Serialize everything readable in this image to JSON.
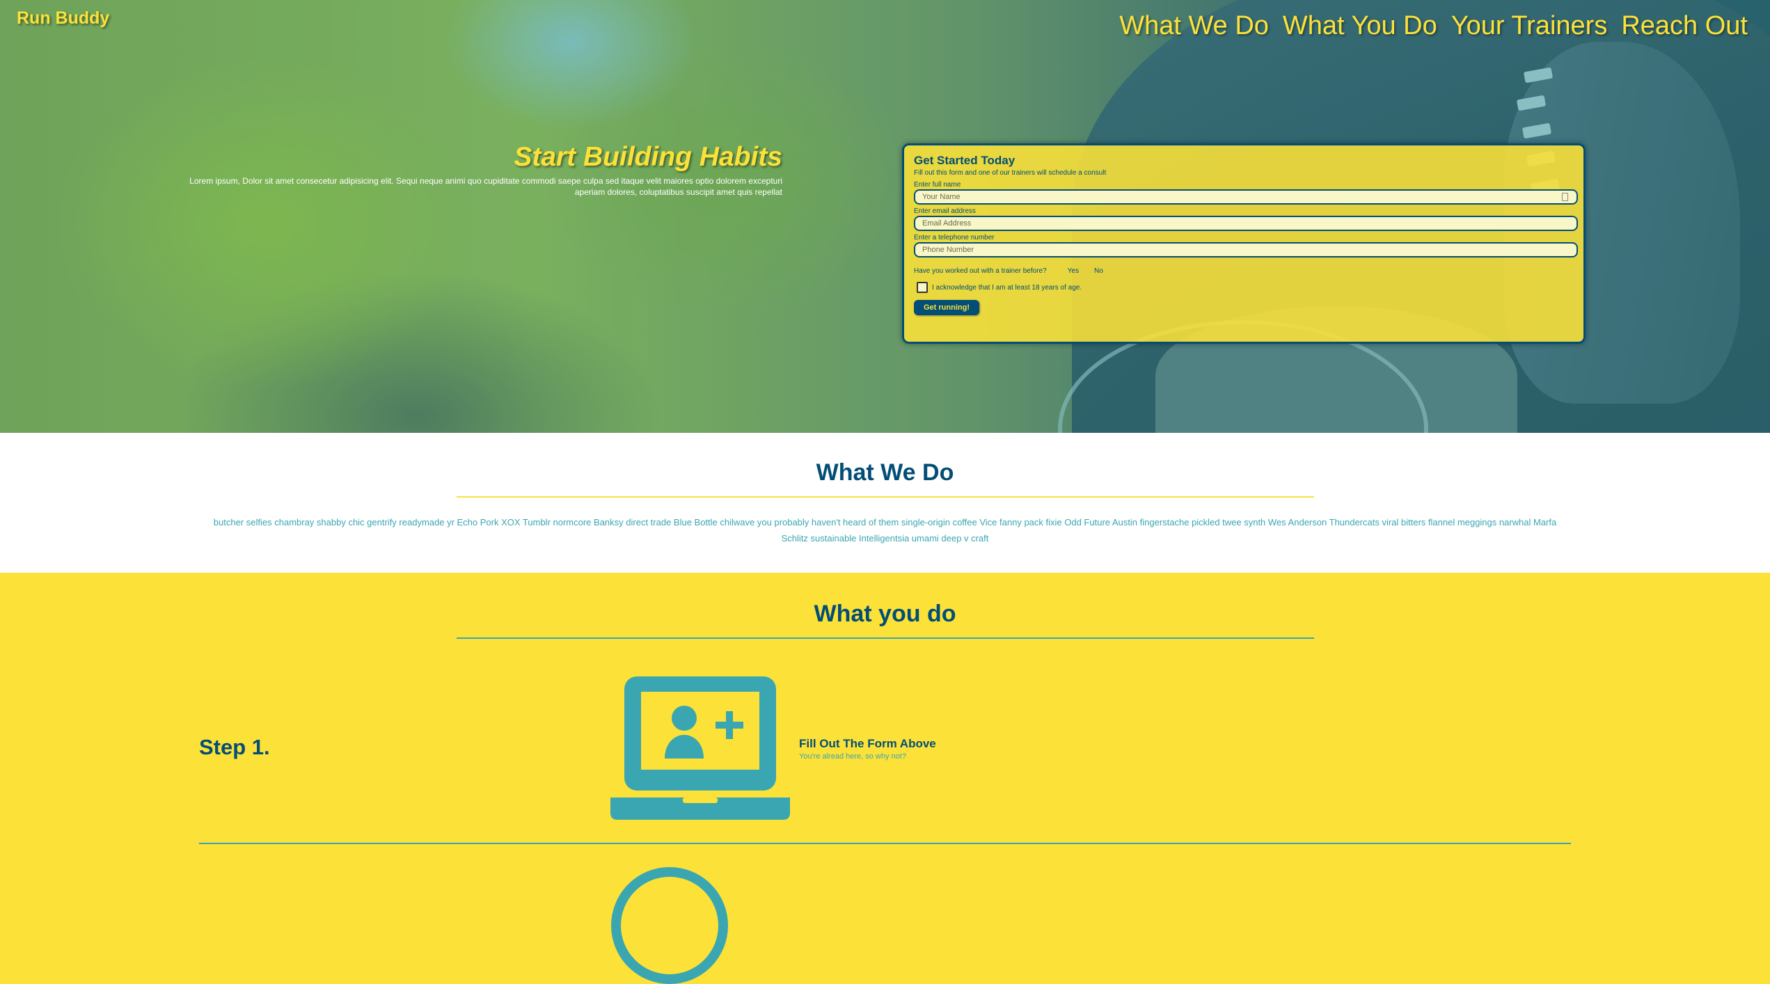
{
  "header": {
    "brand": "Run Buddy",
    "nav": [
      "What We Do",
      "What You Do",
      "Your Trainers",
      "Reach Out"
    ]
  },
  "hero": {
    "title": "Start Building Habits",
    "subtitle": "Lorem ipsum, Dolor sit amet consecetur adipisicing elit. Sequi neque animi quo cupiditate commodi saepe culpa sed itaque velit maiores optio dolorem excepturi aperiam dolores, coluptatibus suscipit amet quis repellat"
  },
  "form": {
    "title": "Get Started Today",
    "subtitle": "Fill out this form and one of our trainers will schedule a consult",
    "name_label": "Enter full name",
    "name_placeholder": "Your Name",
    "email_label": "Enter email address",
    "email_placeholder": "Email Address",
    "phone_label": "Enter a telephone number",
    "phone_placeholder": "Phone Number",
    "trainer_question": "Have you worked out with a trainer before?",
    "yes_label": "Yes",
    "no_label": "No",
    "acknowledge_label": "I acknowledge that I am at least 18 years of age.",
    "submit_label": "Get running!"
  },
  "what_we_do": {
    "title": "What We Do",
    "text": "butcher selfies chambray shabby chic gentrify readymade yr Echo Pork XOX Tumblr normcore Banksy direct trade Blue Bottle chilwave you probably haven't heard of them single-origin coffee Vice fanny pack fixie Odd Future Austin fingerstache pickled twee synth Wes Anderson Thundercats viral bitters flannel meggings narwhal Marfa Schlitz sustainable Intelligentsia umami deep v craft"
  },
  "what_you_do": {
    "title": "What you do",
    "step1": {
      "label": "Step 1.",
      "icon": "laptop-add-user-icon",
      "heading": "Fill Out The Form Above",
      "text": "You're alread here, so why not?"
    }
  },
  "colors": {
    "primary": "#024e76",
    "secondary": "#39a6b2",
    "accent": "#fce138"
  }
}
